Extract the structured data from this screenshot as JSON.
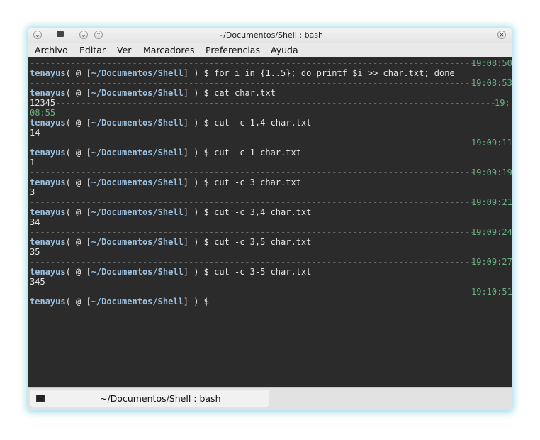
{
  "window": {
    "title": "~/Documentos/Shell : bash"
  },
  "menu": [
    "Archivo",
    "Editar",
    "Ver",
    "Marcadores",
    "Preferencias",
    "Ayuda"
  ],
  "prompt": {
    "user": "tenayus",
    "open": "( @ [",
    "path": "~/Documentos/Shell",
    "close": "] ) $"
  },
  "terminal_lines": [
    {
      "type": "sep",
      "time": "19:08:50"
    },
    {
      "type": "prompt",
      "cmd": "for i in {1..5}; do printf $i >> char.txt; done"
    },
    {
      "type": "sep",
      "time": "19:08:53"
    },
    {
      "type": "prompt",
      "cmd": "cat char.txt"
    },
    {
      "type": "output_sep",
      "text": "12345",
      "time": "19:"
    },
    {
      "type": "wrap",
      "text": "08:55"
    },
    {
      "type": "prompt",
      "cmd": "cut -c 1,4 char.txt"
    },
    {
      "type": "output",
      "text": "14"
    },
    {
      "type": "sep",
      "time": "19:09:11"
    },
    {
      "type": "prompt",
      "cmd": "cut -c 1 char.txt"
    },
    {
      "type": "output",
      "text": "1"
    },
    {
      "type": "sep",
      "time": "19:09:19"
    },
    {
      "type": "prompt",
      "cmd": "cut -c 3 char.txt"
    },
    {
      "type": "output",
      "text": "3"
    },
    {
      "type": "sep",
      "time": "19:09:21"
    },
    {
      "type": "prompt",
      "cmd": "cut -c 3,4 char.txt"
    },
    {
      "type": "output",
      "text": "34"
    },
    {
      "type": "sep",
      "time": "19:09:24"
    },
    {
      "type": "prompt",
      "cmd": "cut -c 3,5 char.txt"
    },
    {
      "type": "output",
      "text": "35"
    },
    {
      "type": "sep",
      "time": "19:09:27"
    },
    {
      "type": "prompt",
      "cmd": "cut -c 3-5 char.txt"
    },
    {
      "type": "output",
      "text": "345"
    },
    {
      "type": "sep",
      "time": "19:10:51"
    },
    {
      "type": "prompt",
      "cmd": ""
    }
  ],
  "tab": {
    "label": "~/Documentos/Shell : bash"
  },
  "colors": {
    "terminal_bg": "#2b2b2b",
    "prompt_blue": "#9cc0e0",
    "timestamp_green": "#68b27f",
    "separator_gray": "#6a6a6a",
    "window_glow": "#50bed2"
  }
}
